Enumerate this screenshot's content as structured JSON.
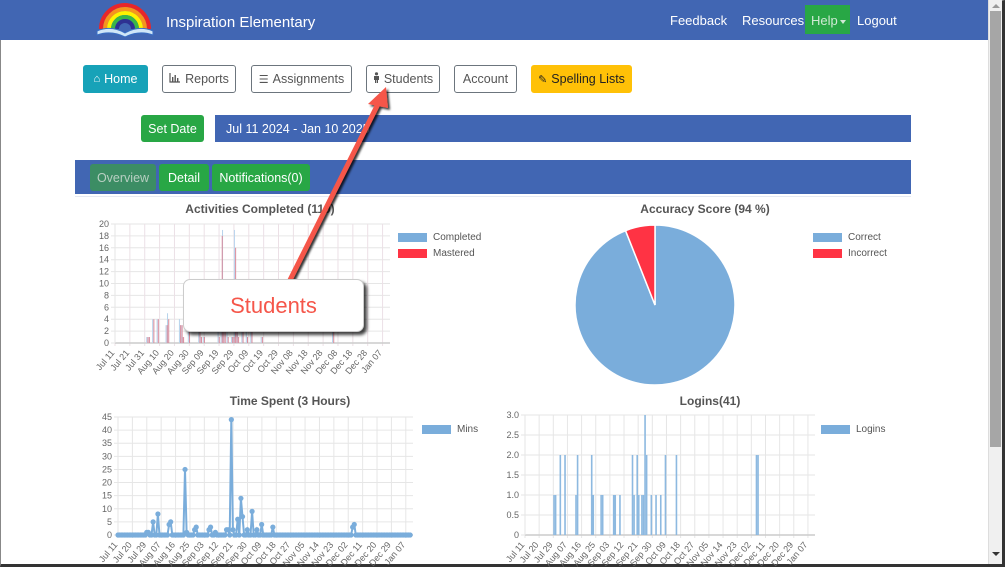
{
  "navbar": {
    "brand": "Inspiration Elementary",
    "links": [
      {
        "label": "Feedback"
      },
      {
        "label": "Resources"
      },
      {
        "label": "Help"
      },
      {
        "label": "Logout"
      }
    ],
    "colors": {
      "bar": "#4166b3",
      "help": "#28a745"
    }
  },
  "toolbar": {
    "home": "Home",
    "reports": "Reports",
    "assignments": "Assignments",
    "students": "Students",
    "account": "Account",
    "spelling_lists": "Spelling Lists"
  },
  "date": {
    "set_label": "Set Date",
    "range": "Jul 11 2024 - Jan 10 2025"
  },
  "tabs": [
    {
      "label": "Overview",
      "active": true
    },
    {
      "label": "Detail",
      "active": false
    },
    {
      "label": "Notifications(0)",
      "active": false
    }
  ],
  "annotation": {
    "callout_text": "Students",
    "color": "#f5564a"
  },
  "chart_data": [
    {
      "type": "bar",
      "title": "Activities Completed (119)",
      "xlabel": "",
      "ylabel": "",
      "ylim": [
        0,
        20
      ],
      "yticks": [
        0,
        2,
        4,
        6,
        8,
        10,
        12,
        14,
        16,
        18,
        20
      ],
      "xticks": [
        "Jul 11",
        "Jul 21",
        "Jul 31",
        "Aug 10",
        "Aug 20",
        "Aug 30",
        "Sep 09",
        "Sep 19",
        "Sep 29",
        "Oct 09",
        "Oct 19",
        "Oct 29",
        "Nov 08",
        "Nov 18",
        "Nov 28",
        "Dec 08",
        "Dec 18",
        "Dec 28",
        "Jan 07"
      ],
      "x_days_total": 183,
      "legend": "top-right",
      "series": [
        {
          "name": "Completed",
          "color": "#7aaddb",
          "points": [
            [
              21,
              1
            ],
            [
              22,
              1
            ],
            [
              25,
              4
            ],
            [
              28,
              4
            ],
            [
              34,
              3
            ],
            [
              35,
              5
            ],
            [
              43,
              4
            ],
            [
              44,
              3
            ],
            [
              45,
              1
            ],
            [
              49,
              2
            ],
            [
              56,
              2
            ],
            [
              57,
              1
            ],
            [
              59,
              1
            ],
            [
              69,
              2
            ],
            [
              71,
              2
            ],
            [
              72,
              19
            ],
            [
              73,
              2
            ],
            [
              75,
              2
            ],
            [
              78,
              1
            ],
            [
              79,
              1
            ],
            [
              80,
              19
            ],
            [
              81,
              3
            ],
            [
              82,
              2
            ],
            [
              85,
              2
            ],
            [
              88,
              2
            ],
            [
              91,
              2
            ],
            [
              98,
              1
            ],
            [
              146,
              2
            ]
          ]
        },
        {
          "name": "Mastered",
          "color": "#ff3344",
          "points": [
            [
              21,
              1
            ],
            [
              22,
              1
            ],
            [
              25,
              4
            ],
            [
              28,
              4
            ],
            [
              34,
              3
            ],
            [
              35,
              4
            ],
            [
              43,
              3
            ],
            [
              44,
              3
            ],
            [
              45,
              1
            ],
            [
              49,
              2
            ],
            [
              56,
              2
            ],
            [
              57,
              1
            ],
            [
              59,
              1
            ],
            [
              69,
              1
            ],
            [
              71,
              18
            ],
            [
              72,
              2
            ],
            [
              73,
              2
            ],
            [
              75,
              1
            ],
            [
              78,
              1
            ],
            [
              79,
              1
            ],
            [
              80,
              16
            ],
            [
              81,
              2
            ],
            [
              82,
              1
            ],
            [
              85,
              2
            ],
            [
              88,
              1
            ],
            [
              91,
              2
            ],
            [
              98,
              1
            ],
            [
              146,
              2
            ]
          ]
        }
      ]
    },
    {
      "type": "pie",
      "title": "Accuracy Score (94 %)",
      "legend": "top-right",
      "slices": [
        {
          "label": "Correct",
          "value": 94,
          "color": "#7aaddb"
        },
        {
          "label": "Incorrect",
          "value": 6,
          "color": "#ff3344"
        }
      ]
    },
    {
      "type": "line",
      "title": "Time Spent (3 Hours)",
      "ylim": [
        0,
        45
      ],
      "yticks": [
        0,
        5,
        10,
        15,
        20,
        25,
        30,
        35,
        40,
        45
      ],
      "xticks": [
        "Jul 11",
        "Jul 20",
        "Jul 29",
        "Aug 07",
        "Aug 16",
        "Aug 25",
        "Sep 03",
        "Sep 12",
        "Sep 21",
        "Sep 30",
        "Oct 09",
        "Oct 18",
        "Oct 27",
        "Nov 05",
        "Nov 14",
        "Nov 23",
        "Dec 02",
        "Dec 11",
        "Dec 20",
        "Dec 29",
        "Jan 07"
      ],
      "x_days_total": 183,
      "legend": "top-right",
      "series": [
        {
          "name": "Mins",
          "color": "#7aaddb",
          "points": [
            [
              18,
              1
            ],
            [
              19,
              1
            ],
            [
              22,
              5
            ],
            [
              25,
              8
            ],
            [
              32,
              4
            ],
            [
              33,
              5
            ],
            [
              42,
              25
            ],
            [
              43,
              1
            ],
            [
              48,
              2
            ],
            [
              49,
              3
            ],
            [
              57,
              2
            ],
            [
              58,
              3
            ],
            [
              61,
              1
            ],
            [
              68,
              2
            ],
            [
              69,
              2
            ],
            [
              71,
              44
            ],
            [
              72,
              2
            ],
            [
              75,
              6
            ],
            [
              77,
              14
            ],
            [
              78,
              7
            ],
            [
              81,
              2
            ],
            [
              84,
              9
            ],
            [
              87,
              2
            ],
            [
              90,
              4
            ],
            [
              97,
              3
            ],
            [
              147,
              3
            ],
            [
              148,
              4
            ]
          ]
        }
      ]
    },
    {
      "type": "bar",
      "title": "Logins(41)",
      "ylim": [
        0,
        3
      ],
      "yticks": [
        "0",
        "0.5",
        "1.0",
        "1.5",
        "2.0",
        "2.5",
        "3.0"
      ],
      "xticks": [
        "Jul 11",
        "Jul 20",
        "Jul 29",
        "Aug 07",
        "Aug 16",
        "Aug 25",
        "Sep 03",
        "Sep 12",
        "Sep 21",
        "Sep 30",
        "Oct 09",
        "Oct 18",
        "Oct 27",
        "Nov 05",
        "Nov 14",
        "Nov 23",
        "Dec 02",
        "Dec 11",
        "Dec 20",
        "Dec 29",
        "Jan 07"
      ],
      "x_days_total": 183,
      "legend": "top-right",
      "series": [
        {
          "name": "Logins",
          "color": "#7aaddb",
          "points": [
            [
              18,
              1
            ],
            [
              19,
              1
            ],
            [
              22,
              2
            ],
            [
              25,
              2
            ],
            [
              32,
              1
            ],
            [
              33,
              2
            ],
            [
              42,
              2
            ],
            [
              43,
              1
            ],
            [
              48,
              1
            ],
            [
              49,
              1
            ],
            [
              56,
              1
            ],
            [
              57,
              1
            ],
            [
              60,
              1
            ],
            [
              68,
              2
            ],
            [
              69,
              1
            ],
            [
              71,
              2
            ],
            [
              72,
              1
            ],
            [
              74,
              1
            ],
            [
              75,
              1
            ],
            [
              76,
              3
            ],
            [
              77,
              2
            ],
            [
              80,
              1
            ],
            [
              83,
              1
            ],
            [
              86,
              1
            ],
            [
              89,
              2
            ],
            [
              96,
              2
            ],
            [
              147,
              2
            ],
            [
              148,
              2
            ]
          ]
        }
      ]
    }
  ]
}
